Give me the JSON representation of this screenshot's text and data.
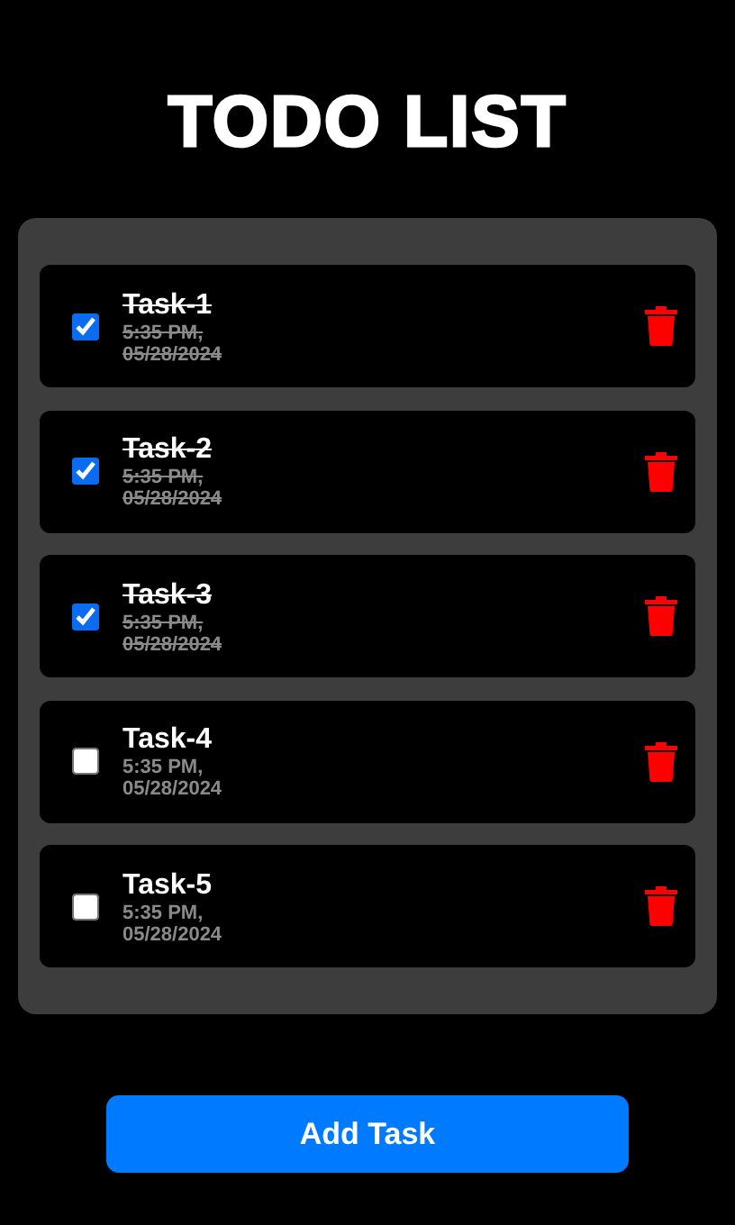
{
  "title": "TODO LIST",
  "tasks": [
    {
      "name": "Task-1",
      "time": "5:35 PM,",
      "date": "05/28/2024",
      "done": true
    },
    {
      "name": "Task-2",
      "time": "5:35 PM,",
      "date": "05/28/2024",
      "done": true
    },
    {
      "name": "Task-3",
      "time": "5:35 PM,",
      "date": "05/28/2024",
      "done": true
    },
    {
      "name": "Task-4",
      "time": "5:35 PM,",
      "date": "05/28/2024",
      "done": false
    },
    {
      "name": "Task-5",
      "time": "5:35 PM,",
      "date": "05/28/2024",
      "done": false
    }
  ],
  "add_button": "Add Task"
}
